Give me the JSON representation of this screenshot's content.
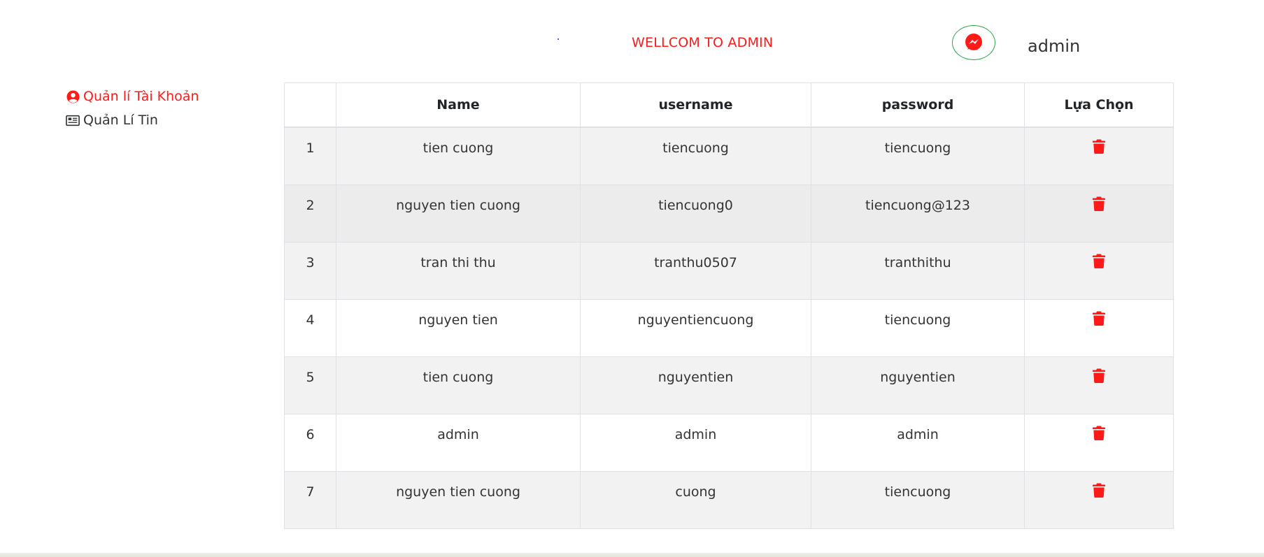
{
  "header": {
    "welcome": "WELLCOM TO ADMIN",
    "user_name": "admin",
    "messenger_icon": "messenger-icon",
    "accent_color": "#ff1a1a"
  },
  "sidebar": {
    "items": [
      {
        "label": "Quản lí Tài Khoản",
        "icon": "user-circle-icon",
        "active": true
      },
      {
        "label": "Quản Lí Tin",
        "icon": "newspaper-icon",
        "active": false
      }
    ]
  },
  "table": {
    "columns": [
      "",
      "Name",
      "username",
      "password",
      "Lựa Chọn"
    ],
    "rows": [
      {
        "index": "1",
        "name": "tien cuong",
        "username": "tiencuong",
        "password": "tiencuong"
      },
      {
        "index": "2",
        "name": "nguyen tien cuong",
        "username": "tiencuong0",
        "password": "tiencuong@123"
      },
      {
        "index": "3",
        "name": "tran thi thu",
        "username": "tranthu0507",
        "password": "tranthithu"
      },
      {
        "index": "4",
        "name": "nguyen tien",
        "username": "nguyentiencuong",
        "password": "tiencuong"
      },
      {
        "index": "5",
        "name": "tien cuong",
        "username": "nguyentien",
        "password": "nguyentien"
      },
      {
        "index": "6",
        "name": "admin",
        "username": "admin",
        "password": "admin"
      },
      {
        "index": "7",
        "name": "nguyen tien cuong",
        "username": "cuong",
        "password": "tiencuong"
      }
    ],
    "action_icon": "trash-icon"
  }
}
